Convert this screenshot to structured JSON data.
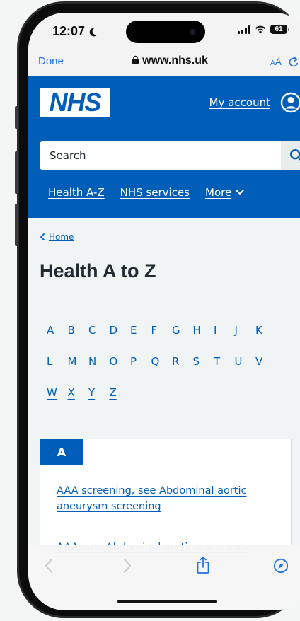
{
  "status_bar": {
    "time": "12:07",
    "battery": "61"
  },
  "browser": {
    "done_label": "Done",
    "url": "www.nhs.uk",
    "text_size_label": "AA"
  },
  "header": {
    "logo_text": "NHS",
    "account_label": "My account",
    "search_placeholder": "Search",
    "nav": {
      "health_az": "Health A-Z",
      "nhs_services": "NHS services",
      "more": "More"
    }
  },
  "breadcrumb": {
    "home_label": "Home"
  },
  "page": {
    "title": "Health A to Z"
  },
  "az": {
    "row1": [
      "A",
      "B",
      "C",
      "D",
      "E",
      "F",
      "G",
      "H",
      "I",
      "J",
      "K"
    ],
    "row2": [
      "L",
      "M",
      "N",
      "O",
      "P",
      "Q",
      "R",
      "S",
      "T",
      "U",
      "V"
    ],
    "row3": [
      "W",
      "X",
      "Y",
      "Z"
    ]
  },
  "section": {
    "letter": "A",
    "links": [
      "AAA screening, see Abdominal aortic aneurysm screening",
      "AAA, see Abdominal aortic aneurysm"
    ]
  },
  "colors": {
    "nhs_blue": "#005eb8",
    "page_background": "#f0f4f5",
    "ios_blue": "#1f6fe5"
  }
}
